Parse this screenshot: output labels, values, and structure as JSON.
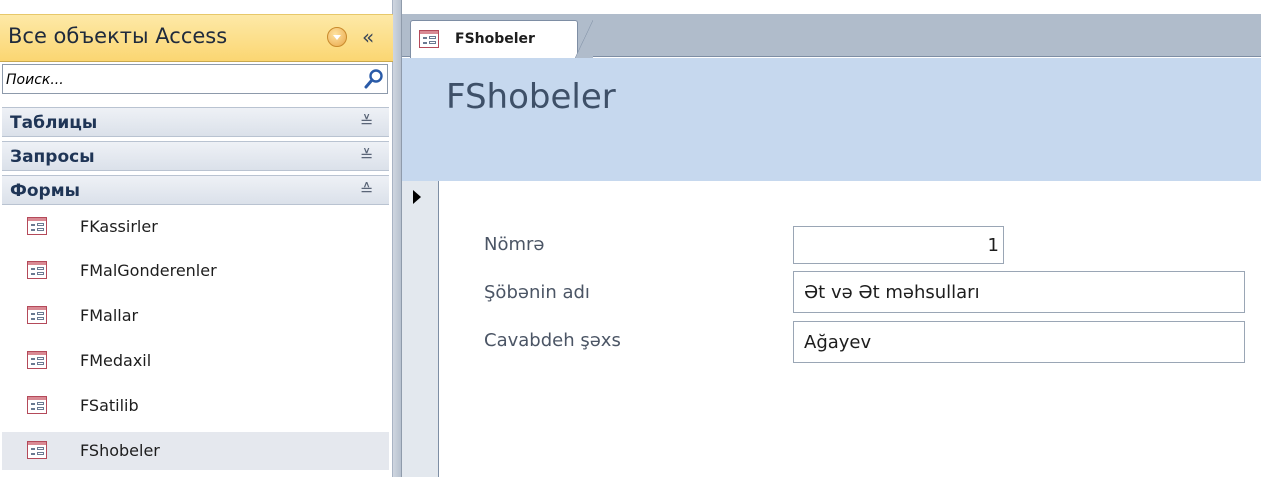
{
  "nav": {
    "title": "Все объекты Access",
    "collapse_symbol": "«",
    "search": {
      "placeholder": "Поиск..."
    },
    "groups": [
      {
        "label": "Таблицы",
        "chevron": "≚"
      },
      {
        "label": "Запросы",
        "chevron": "≚"
      },
      {
        "label": "Формы",
        "chevron": "≙"
      }
    ],
    "forms": [
      {
        "label": "FKassirler"
      },
      {
        "label": "FMalGonderenler"
      },
      {
        "label": "FMallar"
      },
      {
        "label": "FMedaxil"
      },
      {
        "label": "FSatilib"
      },
      {
        "label": "FShobeler"
      }
    ],
    "selected_form": "FShobeler"
  },
  "tab": {
    "label": "FShobeler"
  },
  "form": {
    "title": "FShobeler",
    "fields": [
      {
        "label": "Nömrə",
        "value": "1"
      },
      {
        "label": "Şöbənin adı",
        "value": "Ət və Ət məhsulları"
      },
      {
        "label": "Cavabdeh şəxs",
        "value": "Ağayev"
      }
    ]
  },
  "colors": {
    "nav_header": "#fbd672",
    "form_header": "#c6d8ee",
    "tab_strip": "#b0bccb",
    "form_icon_accent": "#b44a5a"
  },
  "icons": [
    "search-icon",
    "dropdown-icon",
    "collapse-pane-icon",
    "chevron-icon",
    "form-icon",
    "record-selector-pointer-icon"
  ]
}
